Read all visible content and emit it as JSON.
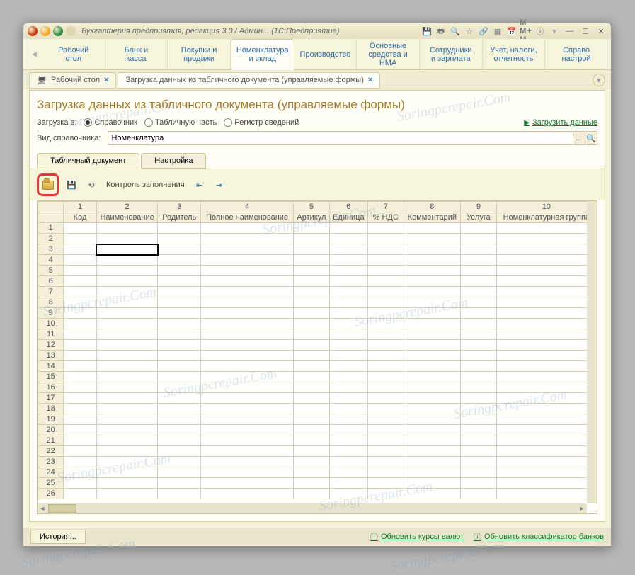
{
  "title": "Бухгалтерия предприятия, редакция 3.0 / Админ...  (1С:Предприятие)",
  "nav": [
    {
      "l1": "Рабочий",
      "l2": "стол"
    },
    {
      "l1": "Банк и",
      "l2": "касса"
    },
    {
      "l1": "Покупки и",
      "l2": "продажи"
    },
    {
      "l1": "Номенклатура",
      "l2": "и склад",
      "active": true
    },
    {
      "l1": "Производство",
      "l2": ""
    },
    {
      "l1": "Основные",
      "l2": "средства и НМА"
    },
    {
      "l1": "Сотрудники",
      "l2": "и зарплата"
    },
    {
      "l1": "Учет, налоги,",
      "l2": "отчетность"
    },
    {
      "l1": "Справо",
      "l2": "настрой"
    }
  ],
  "tabs": [
    {
      "label": "Рабочий стол",
      "close": "×"
    },
    {
      "label": "Загрузка данных из табличного документа (управляемые формы)",
      "close": "×",
      "active": true
    }
  ],
  "page_title": "Загрузка данных из табличного документа (управляемые формы)",
  "row1": {
    "label": "Загрузка в:",
    "opt1": "Справочник",
    "opt2": "Табличную часть",
    "opt3": "Регистр сведений",
    "link": "Загрузить данные"
  },
  "row2": {
    "label": "Вид справочника:",
    "value": "Номенклатура",
    "more": "...",
    "search": "🔍"
  },
  "inner_tabs": {
    "t1": "Табличный документ",
    "t2": "Настройка"
  },
  "toolbar": {
    "control": "Контроль заполнения"
  },
  "grid": {
    "col_nums": [
      "1",
      "2",
      "3",
      "4",
      "5",
      "6",
      "7",
      "8",
      "9",
      "10"
    ],
    "headers": [
      "Код",
      "Наименование",
      "Родитель",
      "Полное наименование",
      "Артикул",
      "Единица",
      "% НДС",
      "Комментарий",
      "Услуга",
      "Номенклатурная группа"
    ],
    "rows": 26
  },
  "status": {
    "history": "История...",
    "l1": "Обновить курсы валют",
    "l2": "Обновить классификатор банков"
  },
  "m_label": "M  M+ M-",
  "watermark": "Soringpcrepair.Com"
}
